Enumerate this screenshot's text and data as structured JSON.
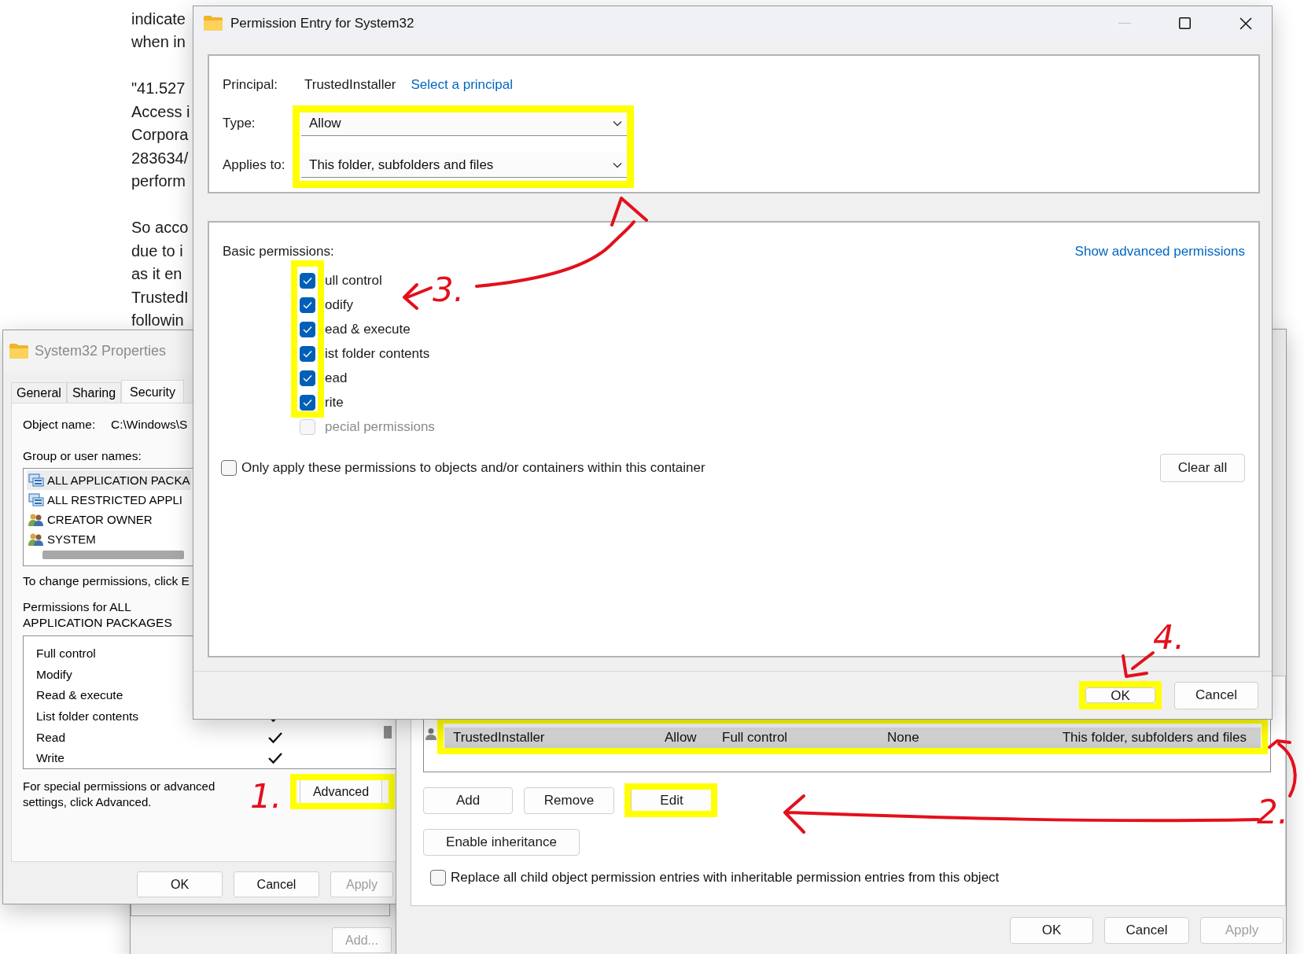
{
  "article": {
    "paragraphs": [
      [
        "indicate",
        "when in"
      ],
      [
        "\"41.527",
        "Access i",
        "Corpora",
        "283634/",
        "perform"
      ],
      [
        "So acco",
        "due to i",
        "as it en",
        "TrustedI",
        "followin"
      ]
    ]
  },
  "properties": {
    "title": "System32 Properties",
    "tabs": [
      {
        "label": "General",
        "selected": false
      },
      {
        "label": "Sharing",
        "selected": false
      },
      {
        "label": "Security",
        "selected": true
      }
    ],
    "object_label": "Object name:",
    "object_value": "C:\\Windows\\S",
    "group_label": "Group or user names:",
    "users": [
      {
        "name": "ALL APPLICATION PACKA",
        "kind": "package",
        "selected": true
      },
      {
        "name": "ALL RESTRICTED APPLI",
        "kind": "package",
        "selected": false
      },
      {
        "name": "CREATOR OWNER",
        "kind": "user",
        "selected": false
      },
      {
        "name": "SYSTEM",
        "kind": "user",
        "selected": false
      }
    ],
    "change_hint": "To change permissions, click E",
    "permissions_label": "Permissions for ALL APPLICATION PACKAGES",
    "permissions": [
      {
        "name": "Full control",
        "allow": false
      },
      {
        "name": "Modify",
        "allow": false
      },
      {
        "name": "Read & execute",
        "allow": false
      },
      {
        "name": "List folder contents",
        "allow": true
      },
      {
        "name": "Read",
        "allow": true
      },
      {
        "name": "Write",
        "allow": true
      }
    ],
    "advanced_hint": "For special permissions or advanced settings, click Advanced.",
    "advanced_button": {
      "label": "Advanced",
      "highlighted": true
    },
    "buttons": [
      {
        "label": "OK",
        "disabled": false
      },
      {
        "label": "Cancel",
        "disabled": false
      },
      {
        "label": "Apply",
        "disabled": true
      }
    ]
  },
  "behind": {
    "button": {
      "label": "Add...",
      "disabled": true
    }
  },
  "advanced_security": {
    "entry": {
      "principal": "TrustedInstaller",
      "type": "Allow",
      "access": "Full control",
      "inherited_from": "None",
      "applies_to": "This folder, subfolders and files",
      "selected": true,
      "highlighted": true
    },
    "buttons": [
      {
        "label": "Add",
        "highlighted": false
      },
      {
        "label": "Remove",
        "highlighted": false
      },
      {
        "label": "Edit",
        "highlighted": true
      }
    ],
    "inheritance_button": "Enable inheritance",
    "replace_checkbox": {
      "label": "Replace all child object permission entries with inheritable permission entries from this object",
      "checked": false
    },
    "footer_buttons": [
      {
        "label": "OK",
        "disabled": false
      },
      {
        "label": "Cancel",
        "disabled": false
      },
      {
        "label": "Apply",
        "disabled": true
      }
    ]
  },
  "permission_entry": {
    "title": "Permission Entry for System32",
    "principal_label": "Principal:",
    "principal": "TrustedInstaller",
    "select_link": "Select a principal",
    "type_label": "Type:",
    "type_value": "Allow",
    "applies_label": "Applies to:",
    "applies_value": "This folder, subfolders and files",
    "selectors_highlighted": true,
    "basic_label": "Basic permissions:",
    "show_advanced_link": "Show advanced permissions",
    "permissions_highlighted": true,
    "permissions": [
      {
        "label": "ull control",
        "checked": true,
        "disabled": false
      },
      {
        "label": "odify",
        "checked": true,
        "disabled": false
      },
      {
        "label": "ead & execute",
        "checked": true,
        "disabled": false
      },
      {
        "label": "ist folder contents",
        "checked": true,
        "disabled": false
      },
      {
        "label": "ead",
        "checked": true,
        "disabled": false
      },
      {
        "label": "rite",
        "checked": true,
        "disabled": false
      },
      {
        "label": "pecial permissions",
        "checked": false,
        "disabled": true
      }
    ],
    "only_apply": {
      "label": "Only apply these permissions to objects and/or containers within this container",
      "checked": false
    },
    "clear_all": "Clear all",
    "buttons": [
      {
        "label": "OK",
        "highlighted": true
      },
      {
        "label": "Cancel",
        "highlighted": false
      }
    ]
  },
  "annotations": [
    {
      "label": "1."
    },
    {
      "label": "2."
    },
    {
      "label": "3."
    },
    {
      "label": "4."
    }
  ]
}
